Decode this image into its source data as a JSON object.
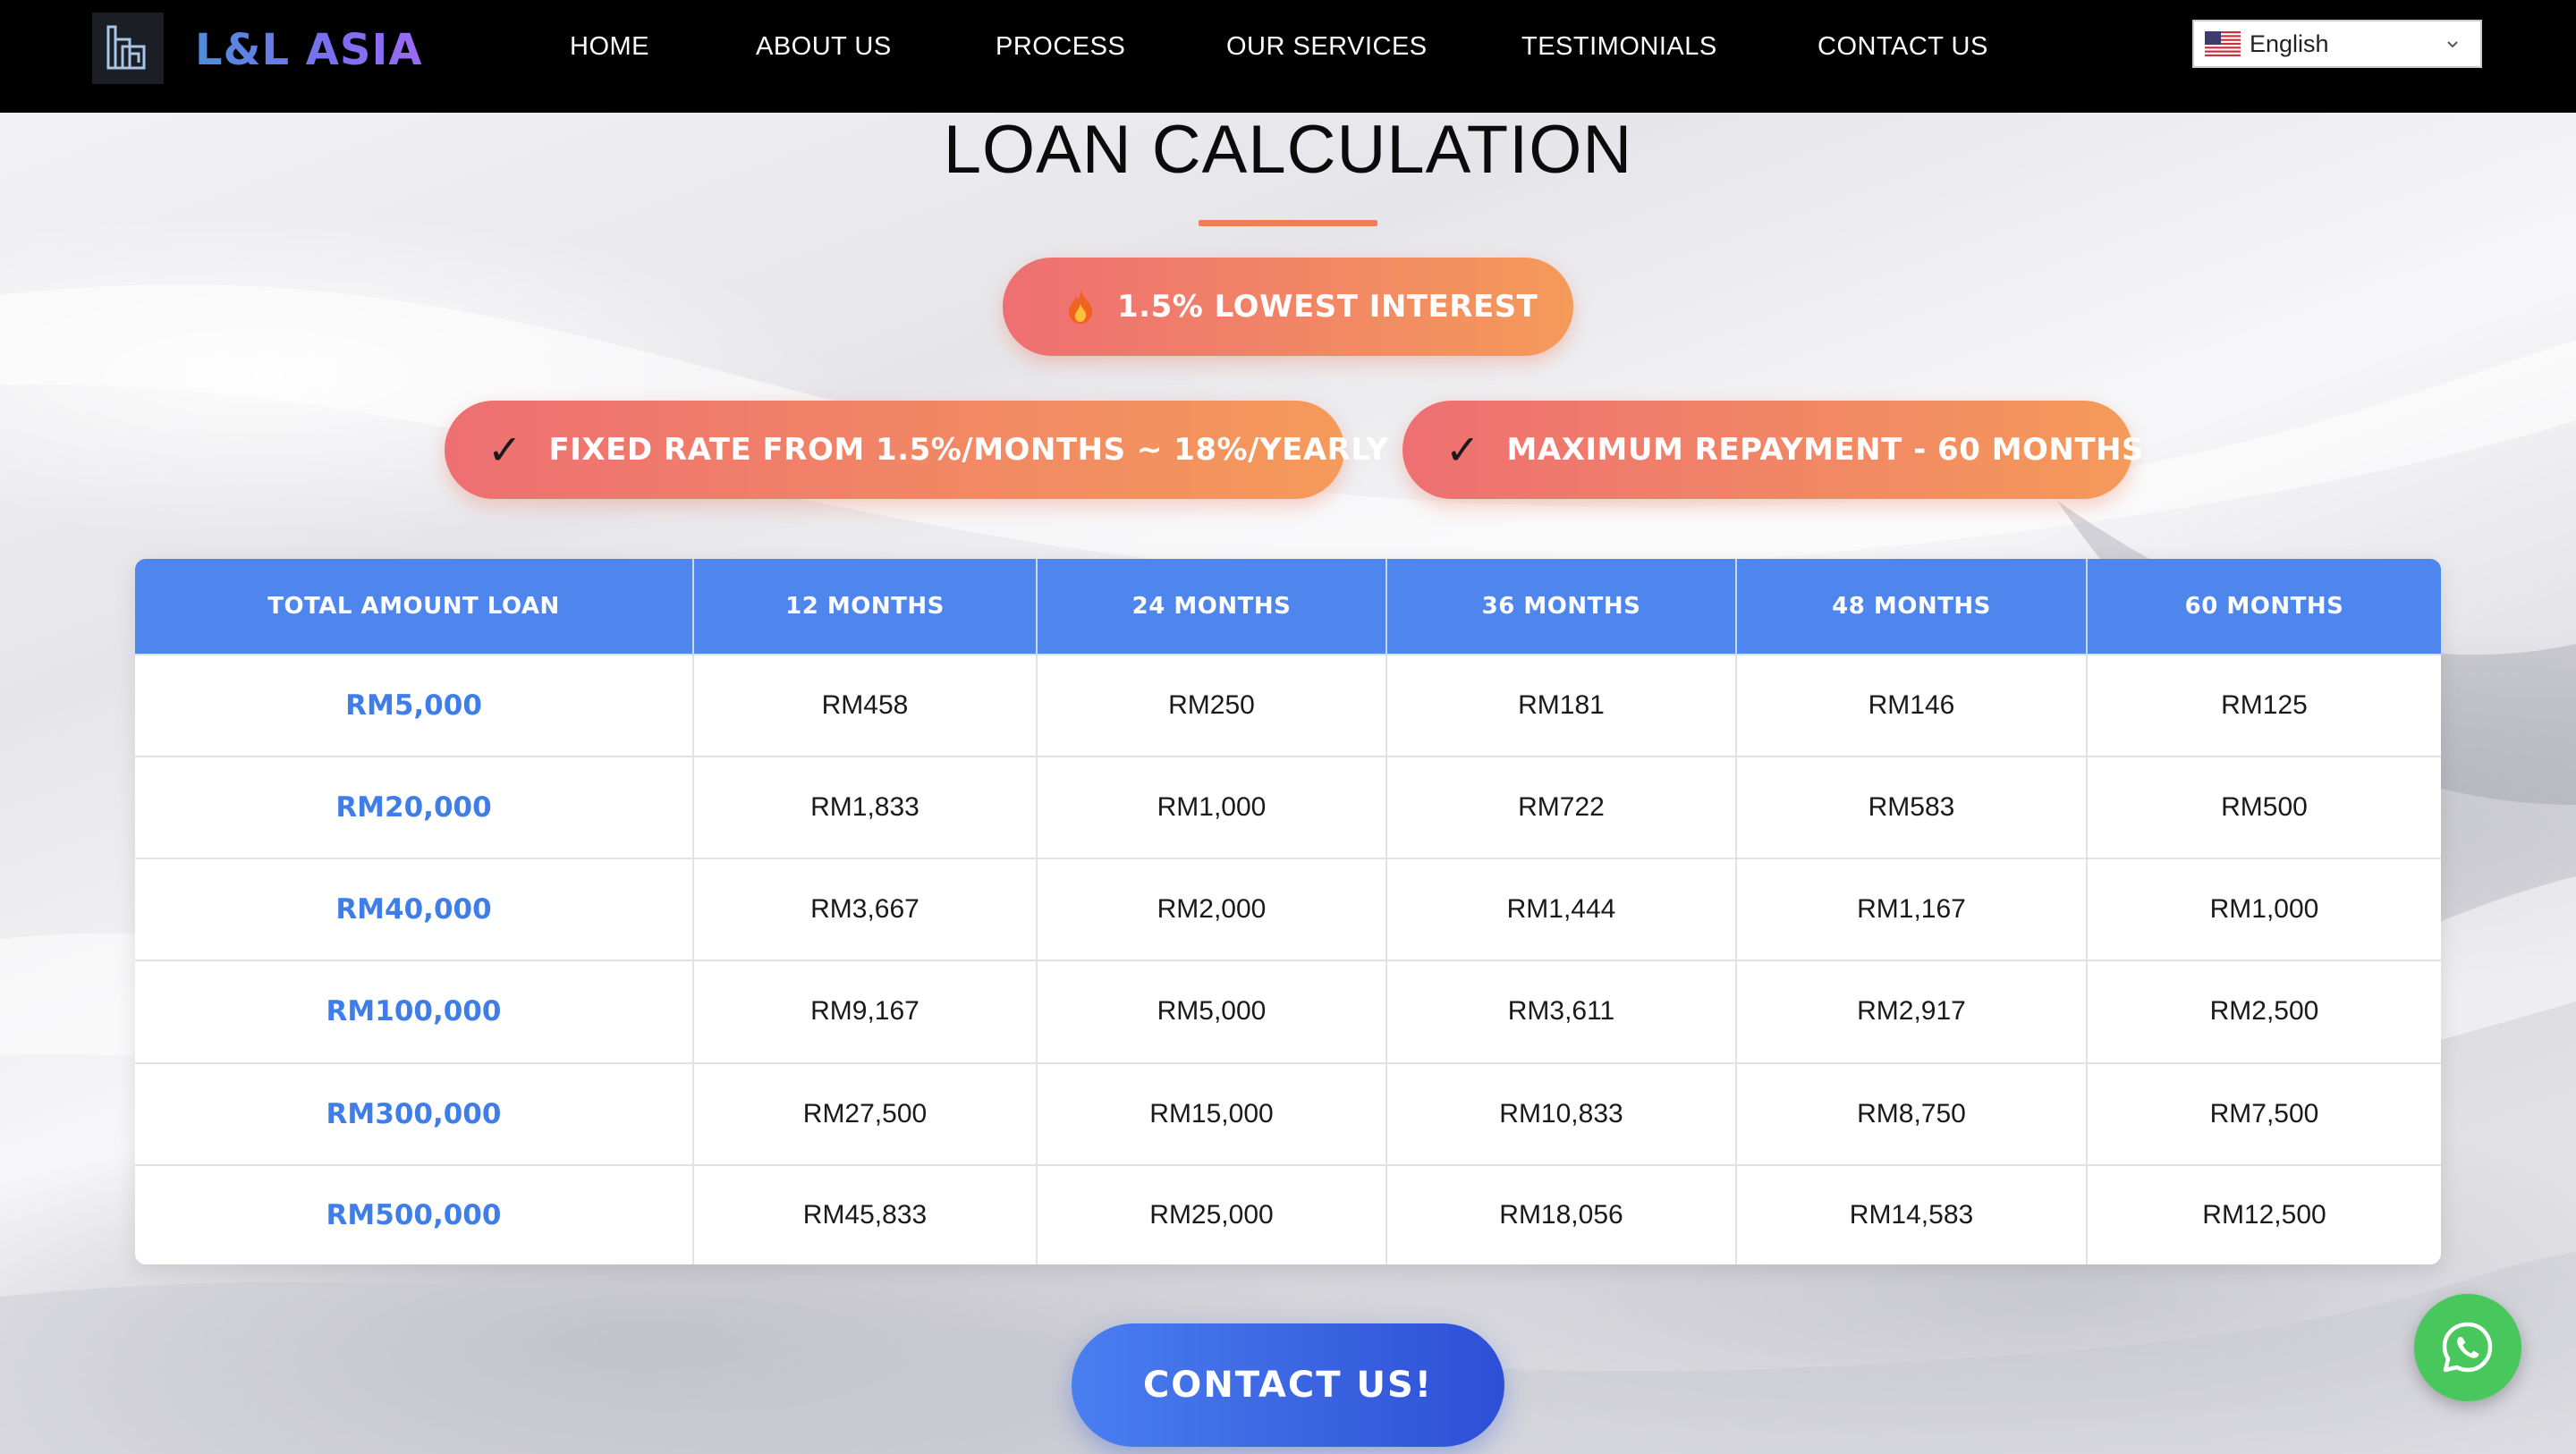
{
  "brand": {
    "name": "L&L ASIA"
  },
  "nav": {
    "items": [
      "HOME",
      "ABOUT US",
      "PROCESS",
      "OUR SERVICES",
      "TESTIMONIALS",
      "CONTACT US"
    ]
  },
  "language": {
    "selected": "English",
    "flag_icon": "us-flag-icon"
  },
  "section": {
    "title": "LOAN CALCULATION",
    "accent_color": "#ef7d5a"
  },
  "badges": {
    "lowest_interest": {
      "icon": "fire-icon",
      "label": "1.5% LOWEST INTEREST"
    },
    "fixed_rate": {
      "icon": "check-icon",
      "label": "FIXED RATE FROM 1.5%/MONTHS ~ 18%/YEARLY"
    },
    "max_repayment": {
      "icon": "check-icon",
      "label": "MAXIMUM REPAYMENT - 60 MONTHS"
    }
  },
  "table": {
    "headers": [
      "TOTAL AMOUNT LOAN",
      "12 MONTHS",
      "24 MONTHS",
      "36 MONTHS",
      "48 MONTHS",
      "60 MONTHS"
    ],
    "rows": [
      [
        "RM5,000",
        "RM458",
        "RM250",
        "RM181",
        "RM146",
        "RM125"
      ],
      [
        "RM20,000",
        "RM1,833",
        "RM1,000",
        "RM722",
        "RM583",
        "RM500"
      ],
      [
        "RM40,000",
        "RM3,667",
        "RM2,000",
        "RM1,444",
        "RM1,167",
        "RM1,000"
      ],
      [
        "RM100,000",
        "RM9,167",
        "RM5,000",
        "RM3,611",
        "RM2,917",
        "RM2,500"
      ],
      [
        "RM300,000",
        "RM27,500",
        "RM15,000",
        "RM10,833",
        "RM8,750",
        "RM7,500"
      ],
      [
        "RM500,000",
        "RM45,833",
        "RM25,000",
        "RM18,056",
        "RM14,583",
        "RM12,500"
      ]
    ],
    "header_color": "#4f86ee",
    "amount_color": "#3f7de8"
  },
  "cta": {
    "label": "CONTACT US!"
  },
  "whatsapp": {
    "icon": "whatsapp-icon",
    "color": "#48c75c"
  }
}
